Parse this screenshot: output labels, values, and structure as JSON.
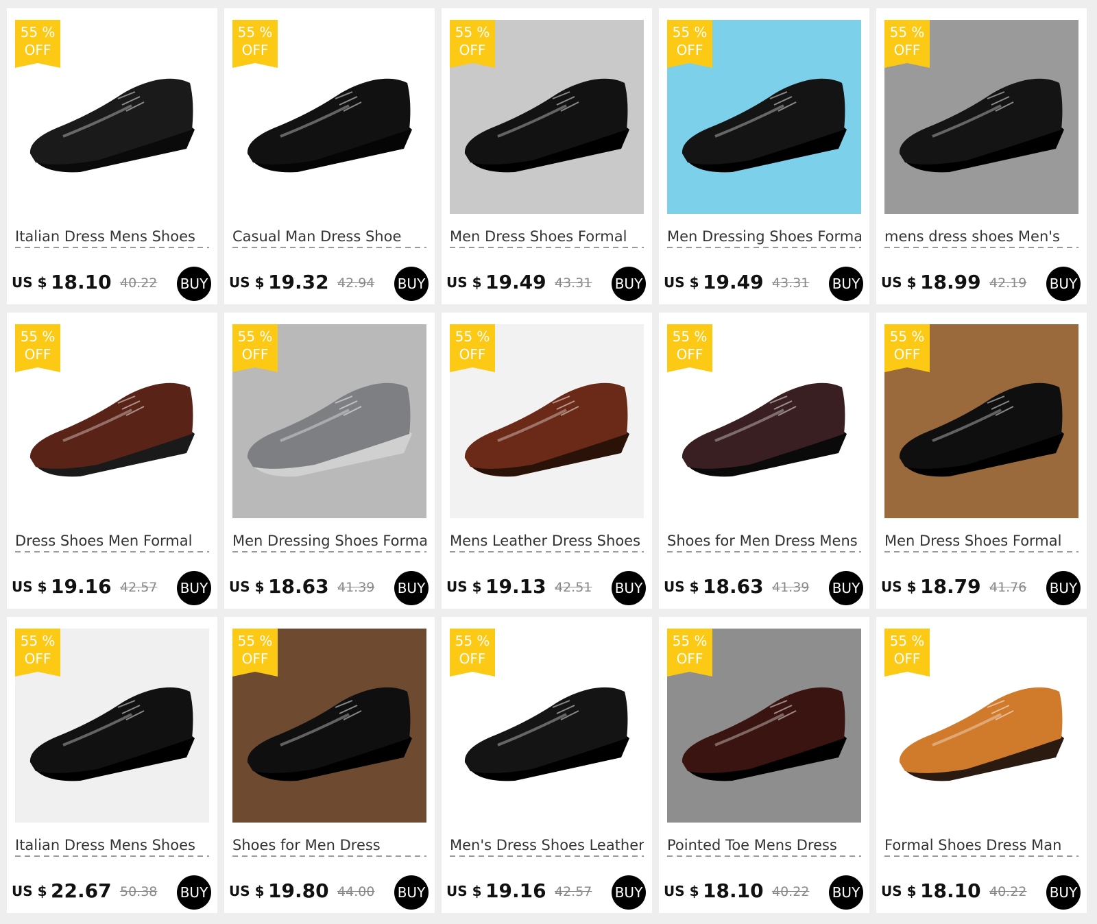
{
  "products": [
    {
      "title": "Italian Dress Mens Shoes",
      "currency": "US $",
      "price": "18.10",
      "old_price": "40.22",
      "badge_line1": "55 %",
      "badge_line2": "OFF",
      "buy_label": "BUY",
      "scene": {
        "bg": "#ffffff",
        "shoe": "#1a1a1a",
        "sole": "#0a0a0a"
      }
    },
    {
      "title": "Casual Man Dress Shoe",
      "currency": "US $",
      "price": "19.32",
      "old_price": "42.94",
      "badge_line1": "55 %",
      "badge_line2": "OFF",
      "buy_label": "BUY",
      "scene": {
        "bg": "#ffffff",
        "shoe": "#111111",
        "sole": "#050505"
      }
    },
    {
      "title": "Men Dress Shoes Formal",
      "currency": "US $",
      "price": "19.49",
      "old_price": "43.31",
      "badge_line1": "55 %",
      "badge_line2": "OFF",
      "buy_label": "BUY",
      "scene": {
        "bg": "#c9c9c9",
        "shoe": "#121212",
        "sole": "#000000"
      }
    },
    {
      "title": "Men Dressing Shoes Formal",
      "currency": "US $",
      "price": "19.49",
      "old_price": "43.31",
      "badge_line1": "55 %",
      "badge_line2": "OFF",
      "buy_label": "BUY",
      "scene": {
        "bg": "#7dd0ea",
        "shoe": "#141414",
        "sole": "#000000"
      }
    },
    {
      "title": "mens dress shoes Men's",
      "currency": "US $",
      "price": "18.99",
      "old_price": "42.19",
      "badge_line1": "55 %",
      "badge_line2": "OFF",
      "buy_label": "BUY",
      "scene": {
        "bg": "#9a9a9a",
        "shoe": "#141414",
        "sole": "#000000"
      }
    },
    {
      "title": "Dress Shoes Men Formal",
      "currency": "US $",
      "price": "19.16",
      "old_price": "42.57",
      "badge_line1": "55 %",
      "badge_line2": "OFF",
      "buy_label": "BUY",
      "scene": {
        "bg": "#ffffff",
        "shoe": "#5a2318",
        "sole": "#1a1a1a"
      }
    },
    {
      "title": "Men Dressing Shoes Formal",
      "currency": "US $",
      "price": "18.63",
      "old_price": "41.39",
      "badge_line1": "55 %",
      "badge_line2": "OFF",
      "buy_label": "BUY",
      "scene": {
        "bg": "#b9b9b9",
        "shoe": "#7d7f82",
        "sole": "#d0d0d0"
      }
    },
    {
      "title": "Mens Leather Dress Shoes",
      "currency": "US $",
      "price": "19.13",
      "old_price": "42.51",
      "badge_line1": "55 %",
      "badge_line2": "OFF",
      "buy_label": "BUY",
      "scene": {
        "bg": "#f2f2f2",
        "shoe": "#6b2a17",
        "sole": "#2a1208"
      }
    },
    {
      "title": "Shoes for Men Dress Mens",
      "currency": "US $",
      "price": "18.63",
      "old_price": "41.39",
      "badge_line1": "55 %",
      "badge_line2": "OFF",
      "buy_label": "BUY",
      "scene": {
        "bg": "#ffffff",
        "shoe": "#3a1f22",
        "sole": "#0a0a0a"
      }
    },
    {
      "title": "Men Dress Shoes Formal",
      "currency": "US $",
      "price": "18.79",
      "old_price": "41.76",
      "badge_line1": "55 %",
      "badge_line2": "OFF",
      "buy_label": "BUY",
      "scene": {
        "bg": "#9a6a3c",
        "shoe": "#0f0f0f",
        "sole": "#000000"
      }
    },
    {
      "title": "Italian Dress Mens Shoes",
      "currency": "US $",
      "price": "22.67",
      "old_price": "50.38",
      "badge_line1": "55 %",
      "badge_line2": "OFF",
      "buy_label": "BUY",
      "scene": {
        "bg": "#f0f0f0",
        "shoe": "#111111",
        "sole": "#000000"
      }
    },
    {
      "title": "Shoes for Men Dress",
      "currency": "US $",
      "price": "19.80",
      "old_price": "44.00",
      "badge_line1": "55 %",
      "badge_line2": "OFF",
      "buy_label": "BUY",
      "scene": {
        "bg": "#6e4a30",
        "shoe": "#0f0f0f",
        "sole": "#000000"
      }
    },
    {
      "title": "Men's Dress Shoes Leather",
      "currency": "US $",
      "price": "19.16",
      "old_price": "42.57",
      "badge_line1": "55 %",
      "badge_line2": "OFF",
      "buy_label": "BUY",
      "scene": {
        "bg": "#ffffff",
        "shoe": "#141414",
        "sole": "#000000"
      }
    },
    {
      "title": "Pointed Toe Mens Dress",
      "currency": "US $",
      "price": "18.10",
      "old_price": "40.22",
      "badge_line1": "55 %",
      "badge_line2": "OFF",
      "buy_label": "BUY",
      "scene": {
        "bg": "#8e8e8e",
        "shoe": "#3a1410",
        "sole": "#000000"
      }
    },
    {
      "title": "Formal Shoes Dress Man",
      "currency": "US $",
      "price": "18.10",
      "old_price": "40.22",
      "badge_line1": "55 %",
      "badge_line2": "OFF",
      "buy_label": "BUY",
      "scene": {
        "bg": "#ffffff",
        "shoe": "#d07a2c",
        "sole": "#2a1a10"
      }
    }
  ],
  "icons": {
    "product_photo": "shoe-photo-icon"
  },
  "colors": {
    "badge": "#fcc914",
    "buy_button": "#000000",
    "card": "#ffffff",
    "page": "#eeeeee",
    "old_price": "#888888"
  }
}
